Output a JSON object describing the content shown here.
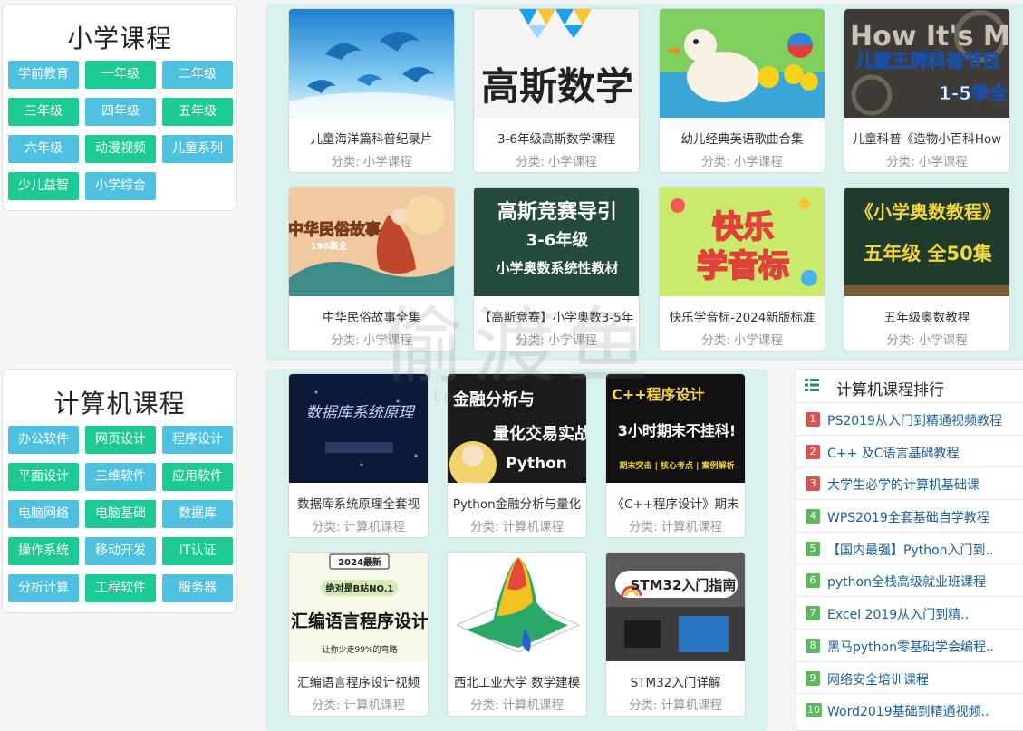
{
  "primary": {
    "title": "小学课程",
    "tags": [
      {
        "label": "学前教育",
        "color": "blue"
      },
      {
        "label": "一年级",
        "color": "green"
      },
      {
        "label": "二年级",
        "color": "blue"
      },
      {
        "label": "三年级",
        "color": "green"
      },
      {
        "label": "四年级",
        "color": "blue"
      },
      {
        "label": "五年级",
        "color": "green"
      },
      {
        "label": "六年级",
        "color": "blue"
      },
      {
        "label": "动漫视频",
        "color": "green"
      },
      {
        "label": "儿童系列",
        "color": "blue"
      },
      {
        "label": "少儿益智",
        "color": "green"
      },
      {
        "label": "小学综合",
        "color": "blue"
      }
    ],
    "cards": [
      {
        "title": "儿童海洋篇科普纪录片",
        "cat_label": "分类:",
        "cat": "小学课程"
      },
      {
        "title": "3-6年级高斯数学课程",
        "cat_label": "分类:",
        "cat": "小学课程",
        "thumb_text": "高斯数学"
      },
      {
        "title": "幼儿经典英语歌曲合集",
        "cat_label": "分类:",
        "cat": "小学课程"
      },
      {
        "title": "儿童科普《造物小百科How",
        "cat_label": "分类:",
        "cat": "小学课程",
        "thumb_text": "儿童王牌科普节目",
        "thumb_text2": "1-5季全",
        "thumb_text3": "How It's Made"
      },
      {
        "title": "中华民俗故事全集",
        "cat_label": "分类:",
        "cat": "小学课程",
        "thumb_text": "中华民俗故事",
        "thumb_text2": "196集全"
      },
      {
        "title": "【高斯竞赛】小学奥数3-5年",
        "cat_label": "分类:",
        "cat": "小学课程",
        "thumb_text": "高斯竞赛导引",
        "thumb_text2": "3-6年级",
        "thumb_text3": "小学奥数系统性教材"
      },
      {
        "title": "快乐学音标-2024新版标准",
        "cat_label": "分类:",
        "cat": "小学课程",
        "thumb_text": "快乐",
        "thumb_text2": "学音标"
      },
      {
        "title": "五年级奥数教程",
        "cat_label": "分类:",
        "cat": "小学课程",
        "thumb_text": "《小学奥数教程》",
        "thumb_text2": "五年级 全50集"
      }
    ]
  },
  "computer": {
    "title": "计算机课程",
    "tags": [
      {
        "label": "办公软件",
        "color": "blue"
      },
      {
        "label": "网页设计",
        "color": "green"
      },
      {
        "label": "程序设计",
        "color": "blue"
      },
      {
        "label": "平面设计",
        "color": "green"
      },
      {
        "label": "三维软件",
        "color": "blue"
      },
      {
        "label": "应用软件",
        "color": "green"
      },
      {
        "label": "电脑网络",
        "color": "blue"
      },
      {
        "label": "电脑基础",
        "color": "green"
      },
      {
        "label": "数据库",
        "color": "blue"
      },
      {
        "label": "操作系统",
        "color": "green"
      },
      {
        "label": "移动开发",
        "color": "blue"
      },
      {
        "label": "IT认证",
        "color": "green"
      },
      {
        "label": "分析计算",
        "color": "blue"
      },
      {
        "label": "工程软件",
        "color": "green"
      },
      {
        "label": "服务器",
        "color": "blue"
      }
    ],
    "cards": [
      {
        "title": "数据库系统原理全套视",
        "cat_label": "分类:",
        "cat": "计算机课程",
        "thumb_text": "数据库系统原理"
      },
      {
        "title": "Python金融分析与量化",
        "cat_label": "分类:",
        "cat": "计算机课程",
        "thumb_text": "金融分析与",
        "thumb_text2": "量化交易实战",
        "thumb_text3": "Python"
      },
      {
        "title": "《C++程序设计》期末",
        "cat_label": "分类:",
        "cat": "计算机课程",
        "thumb_text": "C++程序设计",
        "thumb_text2": "3小时期末不挂科!",
        "thumb_text3": "期末突击 | 核心考点 | 案例解析"
      },
      {
        "title": "汇编语言程序设计视频",
        "cat_label": "分类:",
        "cat": "计算机课程",
        "thumb_text": "2024最新",
        "thumb_text2": "绝对是B站NO.1",
        "thumb_text3": "汇编语言程序设计",
        "thumb_text4": "让你少走99%的弯路"
      },
      {
        "title": "西北工业大学 数学建模",
        "cat_label": "分类:",
        "cat": "计算机课程"
      },
      {
        "title": "STM32入门详解",
        "cat_label": "分类:",
        "cat": "计算机课程",
        "thumb_text": "STM32入门指南"
      }
    ],
    "ranking": {
      "title": "计算机课程排行",
      "items": [
        {
          "num": "1",
          "text": "PS2019从入门到精通视频教程",
          "color": "red"
        },
        {
          "num": "2",
          "text": "C++ 及C语言基础教程",
          "color": "red"
        },
        {
          "num": "3",
          "text": "大学生必学的计算机基础课",
          "color": "red"
        },
        {
          "num": "4",
          "text": "WPS2019全套基础自学教程",
          "color": "green"
        },
        {
          "num": "5",
          "text": "【国内最强】Python入门到..",
          "color": "green"
        },
        {
          "num": "6",
          "text": "python全栈高级就业班课程",
          "color": "green"
        },
        {
          "num": "7",
          "text": "Excel 2019从入门到精..",
          "color": "green"
        },
        {
          "num": "8",
          "text": "黑马python零基础学会编程..",
          "color": "green"
        },
        {
          "num": "9",
          "text": "网络安全培训课程",
          "color": "green"
        },
        {
          "num": "10",
          "text": "Word2019基础到精通视频..",
          "color": "green"
        }
      ]
    }
  },
  "watermark": {
    "main": "偷渡鱼",
    "sub": "toudu"
  },
  "colors": {
    "tag_blue": "#4fc1e0",
    "tag_green": "#1dc994",
    "panel": "#d8f1ef",
    "rank_red": "#d9534f",
    "rank_green": "#5cb85c",
    "rank_link": "#1a5e9a"
  }
}
